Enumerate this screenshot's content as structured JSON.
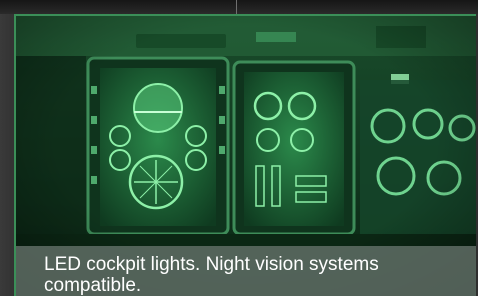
{
  "caption": {
    "text": "LED cockpit lights. Night vision systems compatible."
  },
  "image": {
    "subject": "cockpit-instrument-panel",
    "tint_color": "#1f7a3f",
    "accent_color": "#7fe29a"
  }
}
